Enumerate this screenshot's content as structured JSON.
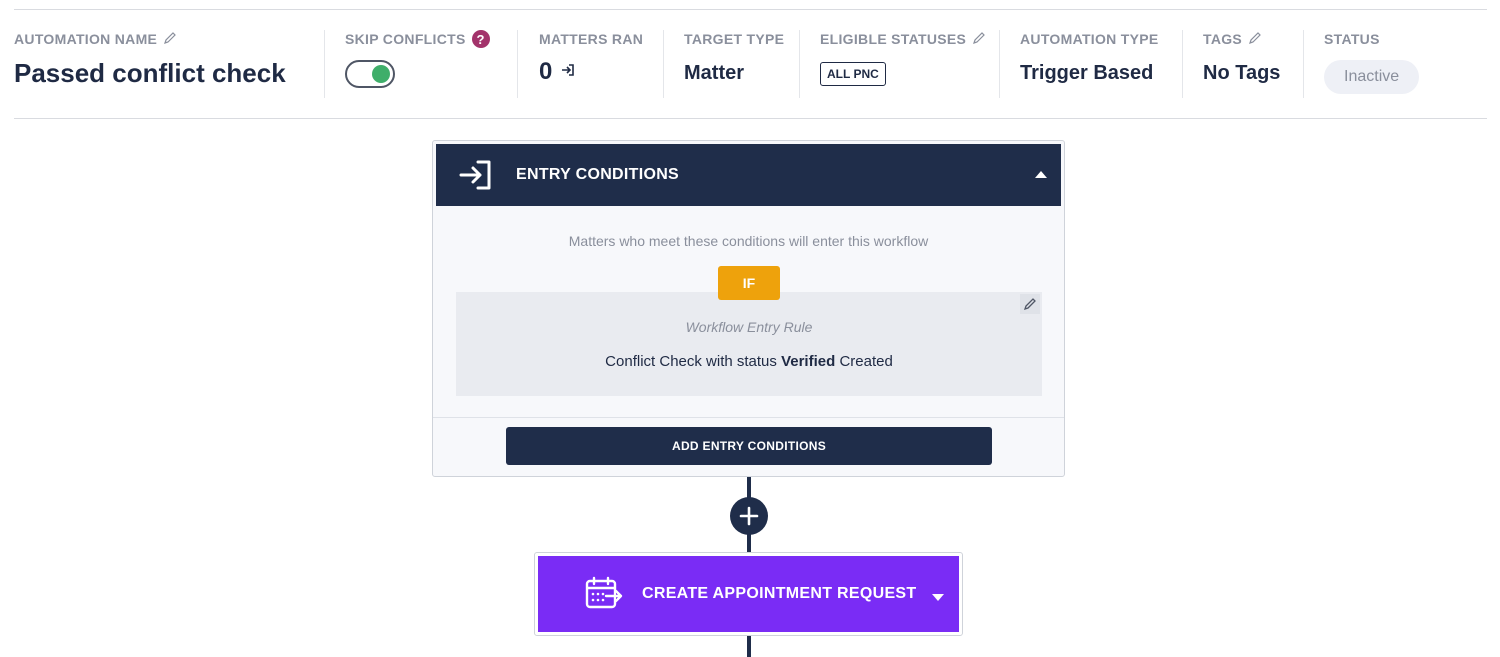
{
  "header": {
    "automation_name": {
      "label": "AUTOMATION NAME",
      "value": "Passed conflict check"
    },
    "skip_conflicts": {
      "label": "SKIP CONFLICTS",
      "help": "?",
      "enabled": true
    },
    "matters_ran": {
      "label": "MATTERS RAN",
      "value": "0"
    },
    "target_type": {
      "label": "TARGET TYPE",
      "value": "Matter"
    },
    "eligible_statuses": {
      "label": "ELIGIBLE STATUSES",
      "chip": "ALL PNC"
    },
    "automation_type": {
      "label": "AUTOMATION TYPE",
      "value": "Trigger Based"
    },
    "tags": {
      "label": "TAGS",
      "value": "No Tags"
    },
    "status": {
      "label": "STATUS",
      "value": "Inactive"
    }
  },
  "entry": {
    "title": "ENTRY CONDITIONS",
    "description": "Matters who meet these conditions will enter this workflow",
    "if_label": "IF",
    "rule_title": "Workflow Entry Rule",
    "rule_prefix": "Conflict Check with status",
    "rule_status": "Verified",
    "rule_suffix": "Created",
    "add_button": "ADD ENTRY CONDITIONS"
  },
  "action": {
    "title": "CREATE APPOINTMENT REQUEST"
  },
  "colors": {
    "navy": "#1f2d4a",
    "purple": "#7a2cf5",
    "amber": "#eea20c",
    "toggle_on": "#3fae6a",
    "help": "#a3336b"
  },
  "icons": [
    "pencil-icon",
    "help-icon",
    "enter-icon",
    "edit-icon",
    "plus-icon",
    "calendar-arrow-icon",
    "caret-up-icon",
    "caret-down-icon"
  ]
}
